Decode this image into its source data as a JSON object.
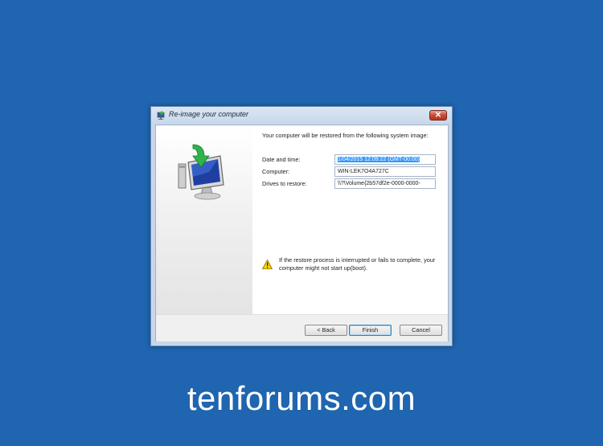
{
  "window": {
    "title": "Re-image your computer",
    "close_label": "✕"
  },
  "content": {
    "intro": "Your computer will be restored from the following system image:",
    "rows": [
      {
        "label": "Date and time:",
        "value": "1/04/2015 12:09:22 (GMT-00:00)",
        "selected": true
      },
      {
        "label": "Computer:",
        "value": "WIN-LEK7O4A727C",
        "selected": false
      },
      {
        "label": "Drives to restore:",
        "value": "\\\\?\\Volume{2b57df2e-0000-0000-",
        "selected": false
      }
    ],
    "warning": "If the restore process is interrupted or fails to complete, your computer might not start up(boot)."
  },
  "buttons": {
    "back": "< Back",
    "finish": "Finish",
    "cancel": "Cancel"
  },
  "icons": {
    "title": "restore-icon",
    "main": "monitor-restore-icon",
    "warning": "warning-icon"
  },
  "watermark": "tenforums.com"
}
